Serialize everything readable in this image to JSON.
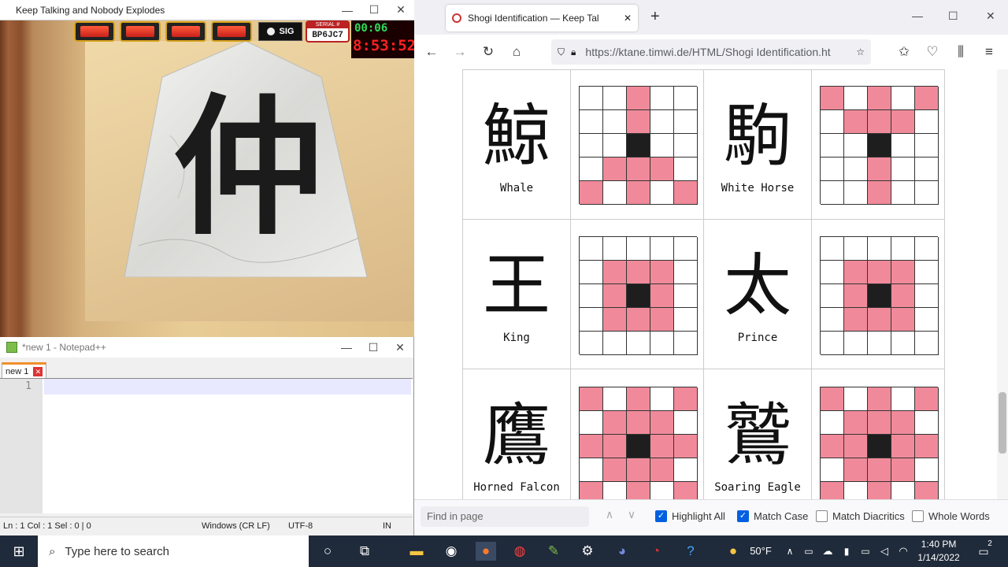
{
  "game_window": {
    "title": "Keep Talking and Nobody Explodes",
    "piece_kanji": "仲",
    "indicator_label": "SIG",
    "serial_label": "SERIAL #",
    "serial_value": "BP6JC7",
    "timer_top": "00:06",
    "timer_main": "8:53:52"
  },
  "notepad": {
    "title": "*new 1 - Notepad++",
    "tab_label": "new 1",
    "line_number": "1",
    "status": {
      "position": "Ln : 1    Col : 1    Sel : 0 | 0",
      "eol": "Windows (CR LF)",
      "encoding": "UTF-8",
      "mode": "IN"
    }
  },
  "browser": {
    "tab_title": "Shogi Identification — Keep Tal",
    "url": "https://ktane.timwi.de/HTML/Shogi Identification.ht",
    "find": {
      "placeholder": "Find in page",
      "highlight_all": "Highlight All",
      "match_case": "Match Case",
      "match_diacritics": "Match Diacritics",
      "whole_words": "Whole Words"
    }
  },
  "pieces": [
    {
      "kanji": "鯨",
      "name": "Whale"
    },
    {
      "kanji": "駒",
      "name": "White Horse"
    },
    {
      "kanji": "王",
      "name": "King"
    },
    {
      "kanji": "太",
      "name": "Prince"
    },
    {
      "kanji": "鷹",
      "name": "Horned Falcon"
    },
    {
      "kanji": "鷲",
      "name": "Soaring Eagle"
    }
  ],
  "move_grids": [
    [
      "00p00",
      "00p00",
      "00b00",
      "0ppp0",
      "p0p0p"
    ],
    [
      "p0p0p",
      "0ppp0",
      "00b00",
      "00p00",
      "00p00"
    ],
    [
      "00000",
      "0ppp0",
      "0pbp0",
      "0ppp0",
      "00000"
    ],
    [
      "00000",
      "0ppp0",
      "0pbp0",
      "0ppp0",
      "00000"
    ],
    [
      "p0p0p",
      "0ppp0",
      "ppbpp",
      "0ppp0",
      "p0p0p"
    ],
    [
      "p0p0p",
      "0ppp0",
      "ppbpp",
      "0ppp0",
      "p0p0p"
    ]
  ],
  "taskbar": {
    "search_placeholder": "Type here to search",
    "weather": "50°F",
    "time": "1:40 PM",
    "date": "1/14/2022",
    "notifications": "2"
  }
}
